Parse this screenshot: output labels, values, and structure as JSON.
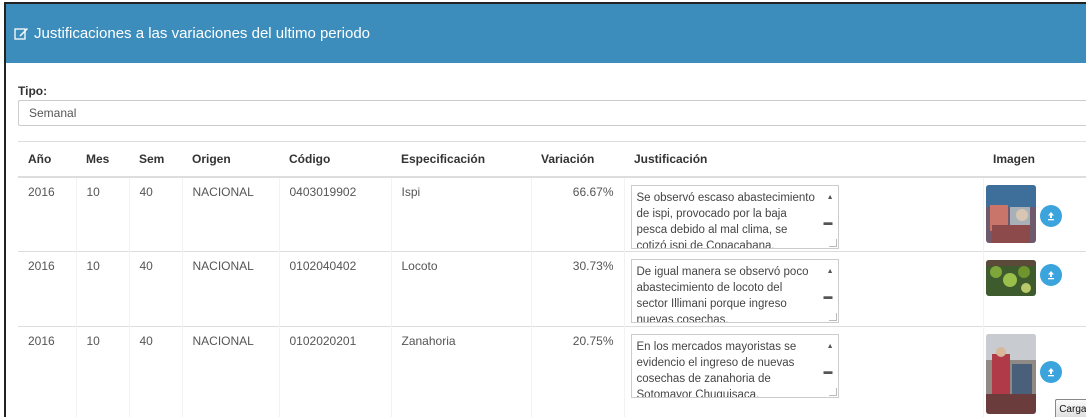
{
  "panel": {
    "title": "Justificaciones a las variaciones del ultimo periodo",
    "title_icon": "edit-icon"
  },
  "filter": {
    "tipo_label": "Tipo:",
    "tipo_value": "Semanal"
  },
  "table": {
    "headers": [
      "Año",
      "Mes",
      "Sem",
      "Origen",
      "Código",
      "Especificación",
      "Variación",
      "Justificación",
      "Imagen"
    ],
    "rows": [
      {
        "anio": "2016",
        "mes": "10",
        "sem": "40",
        "origen": "NACIONAL",
        "codigo": "0403019902",
        "especificacion": "Ispi",
        "variacion": "66.67%",
        "justificacion": "Se observó escaso abastecimiento de ispi, provocado por la baja pesca  debido al mal clima, se cotizó ispi de Copacabana."
      },
      {
        "anio": "2016",
        "mes": "10",
        "sem": "40",
        "origen": "NACIONAL",
        "codigo": "0102040402",
        "especificacion": "Locoto",
        "variacion": "30.73%",
        "justificacion": "De igual manera se observó poco abastecimiento de locoto del sector Illimani porque ingreso nuevas cosechas."
      },
      {
        "anio": "2016",
        "mes": "10",
        "sem": "40",
        "origen": "NACIONAL",
        "codigo": "0102020201",
        "especificacion": "Zanahoria",
        "variacion": "20.75%",
        "justificacion": "En los mercados mayoristas  se evidencio el ingreso de nuevas cosechas de zanahoria de Sotomayor Chuquisaca."
      }
    ]
  },
  "upload": {
    "icon": "upload-icon",
    "cargar_label": "Cargar"
  },
  "colors": {
    "header_bg": "#3c8dbc",
    "upload_btn": "#3ba4dc"
  }
}
